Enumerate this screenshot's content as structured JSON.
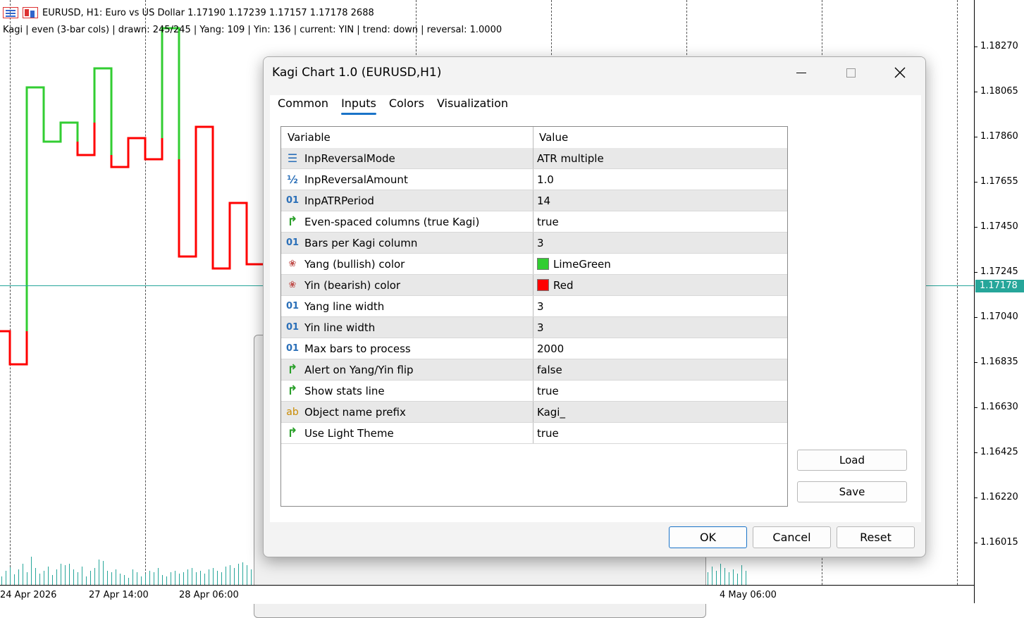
{
  "chart": {
    "symbol_line": "EURUSD, H1:  Euro vs US Dollar  1.17190 1.17239 1.17157 1.17178  2688",
    "stats_line": "Kagi  |  even (3-bar cols)  |  drawn: 245/245  |  Yang: 109  |  Yin: 136  |  current: YIN  |  trend: down  |  reversal: 1.0000",
    "price_labels": [
      "1.18270",
      "1.18065",
      "1.17860",
      "1.17655",
      "1.17450",
      "1.17245",
      "1.17040",
      "1.16835",
      "1.16630",
      "1.16425",
      "1.16220",
      "1.16015"
    ],
    "current_price": "1.17178",
    "time_labels": [
      "24 Apr 2026",
      "27 Apr 14:00",
      "28 Apr 06:00",
      "4 May 06:00"
    ],
    "colors": {
      "yang": "#32cd32",
      "yin": "#ff0000",
      "current_price": "#26a69a"
    }
  },
  "dialog": {
    "title": "Kagi Chart 1.0 (EURUSD,H1)",
    "tabs": [
      {
        "label": "Common"
      },
      {
        "label": "Inputs"
      },
      {
        "label": "Colors"
      },
      {
        "label": "Visualization"
      }
    ],
    "active_tab": "Inputs",
    "grid_headers": {
      "variable": "Variable",
      "value": "Value"
    },
    "rows": [
      {
        "icon": "enum-icon",
        "variable": "InpReversalMode",
        "value": "ATR multiple"
      },
      {
        "icon": "double-icon",
        "variable": "InpReversalAmount",
        "value": "1.0"
      },
      {
        "icon": "int-icon",
        "variable": "InpATRPeriod",
        "value": "14"
      },
      {
        "icon": "bool-icon",
        "variable": "Even-spaced columns (true Kagi)",
        "value": "true"
      },
      {
        "icon": "int-icon",
        "variable": "Bars per Kagi column",
        "value": "3"
      },
      {
        "icon": "color-icon",
        "variable": "Yang (bullish) color",
        "value": "LimeGreen",
        "swatch": "#32cd32"
      },
      {
        "icon": "color-icon",
        "variable": "Yin (bearish) color",
        "value": "Red",
        "swatch": "#ff0000"
      },
      {
        "icon": "int-icon",
        "variable": "Yang line width",
        "value": "3"
      },
      {
        "icon": "int-icon",
        "variable": "Yin line width",
        "value": "3"
      },
      {
        "icon": "int-icon",
        "variable": "Max bars to process",
        "value": "2000"
      },
      {
        "icon": "bool-icon",
        "variable": "Alert on Yang/Yin flip",
        "value": "false"
      },
      {
        "icon": "bool-icon",
        "variable": "Show stats line",
        "value": "true"
      },
      {
        "icon": "string-icon",
        "variable": "Object name prefix",
        "value": "Kagi_"
      },
      {
        "icon": "bool-icon",
        "variable": "Use Light Theme",
        "value": "true"
      }
    ],
    "buttons": {
      "load": "Load",
      "save": "Save",
      "ok": "OK",
      "cancel": "Cancel",
      "reset": "Reset"
    }
  }
}
